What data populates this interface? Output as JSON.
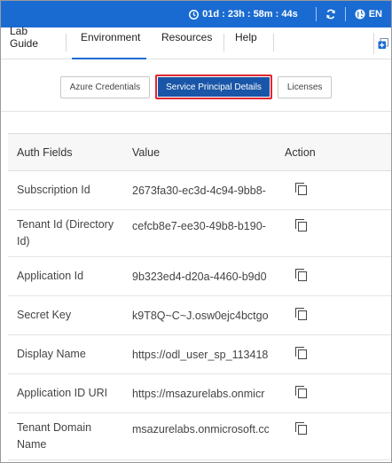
{
  "topbar": {
    "timer": "01d : 23h : 58m : 44s",
    "language": "EN",
    "icons": [
      "clock-icon",
      "refresh-icon",
      "globe-icon"
    ],
    "bg_color": "#1a6bd1"
  },
  "nav": {
    "tabs": [
      {
        "label": "Lab Guide",
        "active": false
      },
      {
        "label": "Environment",
        "active": true
      },
      {
        "label": "Resources",
        "active": false
      },
      {
        "label": "Help",
        "active": false
      }
    ]
  },
  "subnav": {
    "buttons": [
      {
        "label": "Azure Credentials",
        "active": false
      },
      {
        "label": "Service Principal Details",
        "active": true
      },
      {
        "label": "Licenses",
        "active": false
      }
    ],
    "active_color": "#1a56a8",
    "highlight_border": "#e0262e"
  },
  "table": {
    "headers": {
      "field": "Auth Fields",
      "value": "Value",
      "action": "Action"
    },
    "rows": [
      {
        "field": "Subscription Id",
        "value": "2673fa30-ec3d-4c94-9bb8-"
      },
      {
        "field": "Tenant Id (Directory Id)",
        "value": "cefcb8e7-ee30-49b8-b190-"
      },
      {
        "field": "Application Id",
        "value": "9b323ed4-d20a-4460-b9d0"
      },
      {
        "field": "Secret Key",
        "value": "k9T8Q~C~J.osw0ejc4bctgo"
      },
      {
        "field": "Display Name",
        "value": "https://odl_user_sp_113418"
      },
      {
        "field": "Application ID URI",
        "value": "https://msazurelabs.onmicr"
      },
      {
        "field": "Tenant Domain Name",
        "value": "msazurelabs.onmicrosoft.cc"
      }
    ]
  }
}
